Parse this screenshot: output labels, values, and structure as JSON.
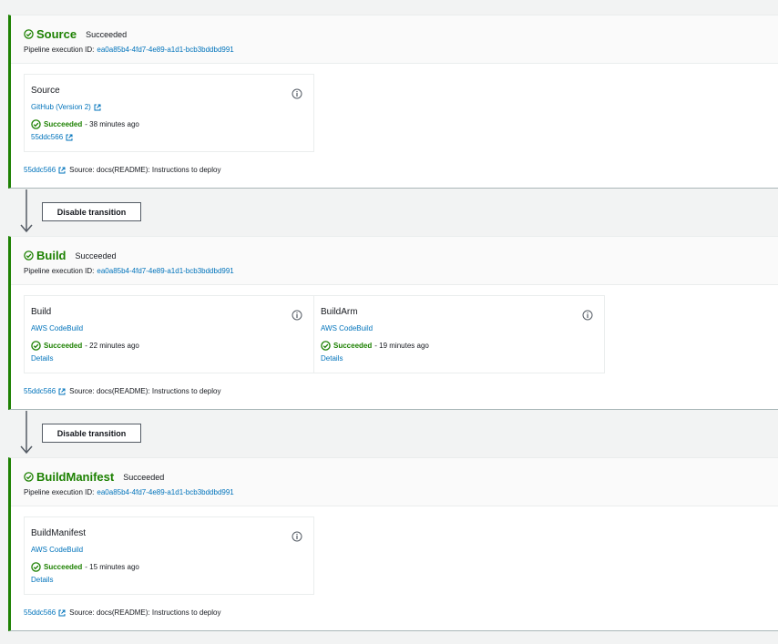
{
  "colors": {
    "success": "#1d8102",
    "link": "#0073bb",
    "border": "#aab7b8"
  },
  "transition_button_label": "Disable transition",
  "stages": [
    {
      "name": "Source",
      "status": "Succeeded",
      "exec_label": "Pipeline execution ID:",
      "exec_id": "ea0a85b4-4fd7-4e89-a1d1-bcb3bddbd991",
      "actions": [
        {
          "name": "Source",
          "provider": "GitHub (Version 2)",
          "status": "Succeeded",
          "time": "- 38 minutes ago",
          "link": "55ddc566"
        }
      ],
      "footer": {
        "commit": "55ddc566",
        "message": "Source: docs(README): Instructions to deploy"
      }
    },
    {
      "name": "Build",
      "status": "Succeeded",
      "exec_label": "Pipeline execution ID:",
      "exec_id": "ea0a85b4-4fd7-4e89-a1d1-bcb3bddbd991",
      "actions": [
        {
          "name": "Build",
          "provider": "AWS CodeBuild",
          "status": "Succeeded",
          "time": "- 22 minutes ago",
          "link": "Details"
        },
        {
          "name": "BuildArm",
          "provider": "AWS CodeBuild",
          "status": "Succeeded",
          "time": "- 19 minutes ago",
          "link": "Details"
        }
      ],
      "footer": {
        "commit": "55ddc566",
        "message": "Source: docs(README): Instructions to deploy"
      }
    },
    {
      "name": "BuildManifest",
      "status": "Succeeded",
      "exec_label": "Pipeline execution ID:",
      "exec_id": "ea0a85b4-4fd7-4e89-a1d1-bcb3bddbd991",
      "actions": [
        {
          "name": "BuildManifest",
          "provider": "AWS CodeBuild",
          "status": "Succeeded",
          "time": "- 15 minutes ago",
          "link": "Details"
        }
      ],
      "footer": {
        "commit": "55ddc566",
        "message": "Source: docs(README): Instructions to deploy"
      }
    }
  ]
}
